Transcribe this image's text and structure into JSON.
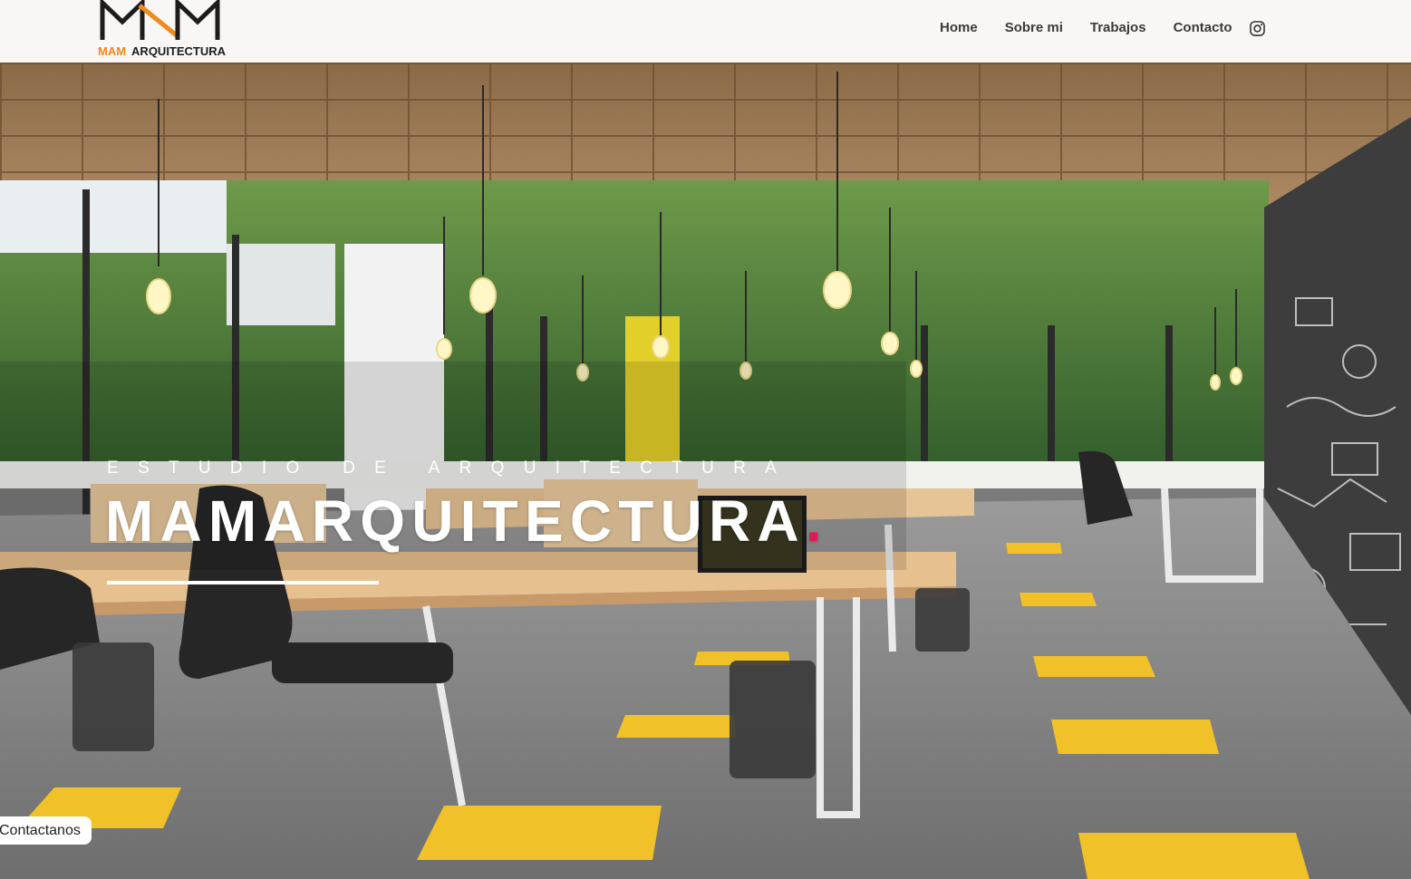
{
  "brand": {
    "mark_name": "mam-logo-mark",
    "name_primary": "MAM",
    "name_secondary": "ARQUITECTURA",
    "accent_color": "#f08a1c"
  },
  "nav": {
    "items": [
      "Home",
      "Sobre mi",
      "Trabajos",
      "Contacto"
    ],
    "social_icon": "instagram-icon"
  },
  "hero": {
    "eyebrow": "ESTUDIO DE ARQUITECTURA",
    "title": "MAMARQUITECTURA",
    "title_dot": ".",
    "dot_color": "#e0195a",
    "cta_label": "Contactanos"
  }
}
